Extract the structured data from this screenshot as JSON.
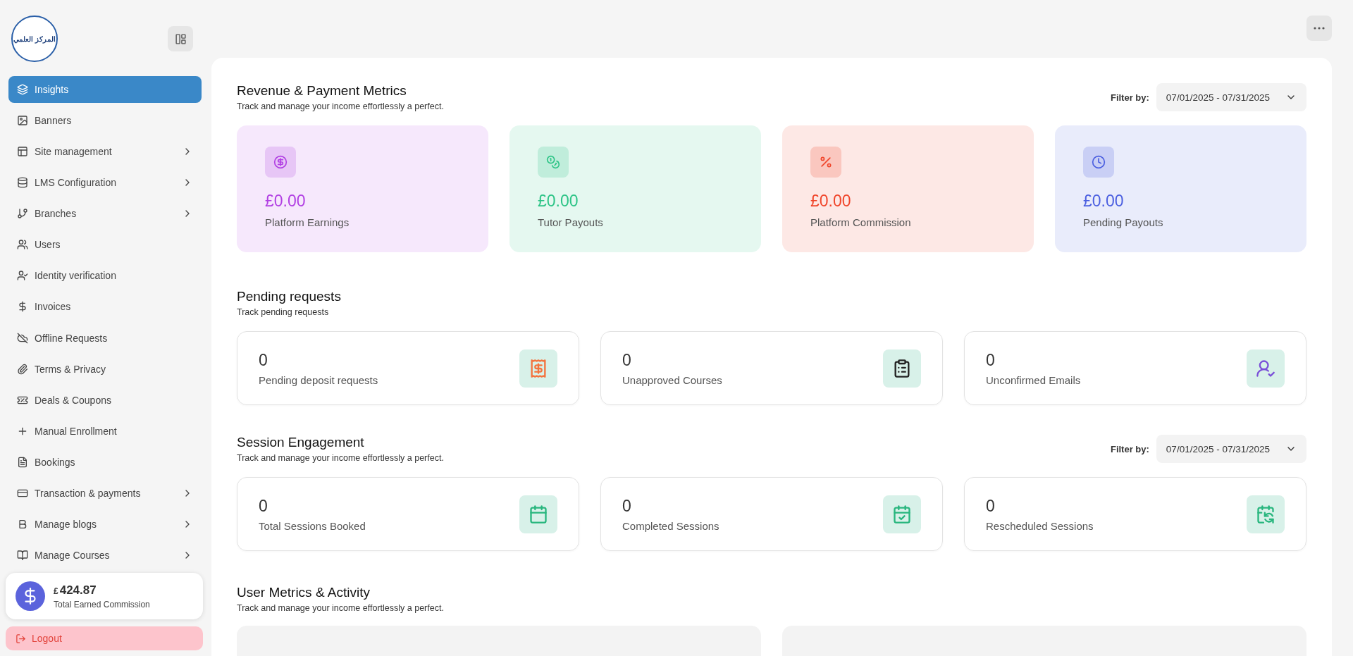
{
  "logo_text": "المركز العلمي",
  "sidebar": {
    "items": [
      {
        "label": "Insights",
        "selected": true,
        "expandable": false
      },
      {
        "label": "Banners",
        "selected": false,
        "expandable": false
      },
      {
        "label": "Site management",
        "selected": false,
        "expandable": true
      },
      {
        "label": "LMS Configuration",
        "selected": false,
        "expandable": true
      },
      {
        "label": "Branches",
        "selected": false,
        "expandable": true
      },
      {
        "label": "Users",
        "selected": false,
        "expandable": false
      },
      {
        "label": "Identity verification",
        "selected": false,
        "expandable": false
      },
      {
        "label": "Invoices",
        "selected": false,
        "expandable": false
      },
      {
        "label": "Offline Requests",
        "selected": false,
        "expandable": false
      },
      {
        "label": "Terms & Privacy",
        "selected": false,
        "expandable": false
      },
      {
        "label": "Deals & Coupons",
        "selected": false,
        "expandable": false
      },
      {
        "label": "Manual Enrollment",
        "selected": false,
        "expandable": false
      },
      {
        "label": "Bookings",
        "selected": false,
        "expandable": false
      },
      {
        "label": "Transaction & payments",
        "selected": false,
        "expandable": true
      },
      {
        "label": "Manage blogs",
        "selected": false,
        "expandable": true
      },
      {
        "label": "Manage Courses",
        "selected": false,
        "expandable": true
      }
    ],
    "commission": {
      "currency": "£",
      "amount": "424.87",
      "label": "Total Earned Commission"
    },
    "logout": "Logout"
  },
  "revenue": {
    "title": "Revenue & Payment Metrics",
    "subtitle": "Track and manage your income effortlessly a perfect.",
    "filter_label": "Filter by:",
    "filter_value": "07/01/2025 - 07/31/2025",
    "cards": [
      {
        "amount": "£0.00",
        "label": "Platform Earnings",
        "color": "#b13fe3"
      },
      {
        "amount": "£0.00",
        "label": "Tutor Payouts",
        "color": "#2cc486"
      },
      {
        "amount": "£0.00",
        "label": "Platform Commission",
        "color": "#f0452a"
      },
      {
        "amount": "£0.00",
        "label": "Pending Payouts",
        "color": "#4b5fe0"
      }
    ]
  },
  "pending": {
    "title": "Pending requests",
    "subtitle": "Track pending requests",
    "cards": [
      {
        "value": "0",
        "label": "Pending deposit requests"
      },
      {
        "value": "0",
        "label": "Unapproved Courses"
      },
      {
        "value": "0",
        "label": "Unconfirmed Emails"
      }
    ]
  },
  "sessions": {
    "title": "Session Engagement",
    "subtitle": "Track and manage your income effortlessly a perfect.",
    "filter_label": "Filter by:",
    "filter_value": "07/01/2025 - 07/31/2025",
    "cards": [
      {
        "value": "0",
        "label": "Total Sessions Booked"
      },
      {
        "value": "0",
        "label": "Completed Sessions"
      },
      {
        "value": "0",
        "label": "Rescheduled Sessions"
      }
    ]
  },
  "user_metrics": {
    "title": "User Metrics & Activity",
    "subtitle": "Track and manage your income effortlessly a perfect."
  }
}
